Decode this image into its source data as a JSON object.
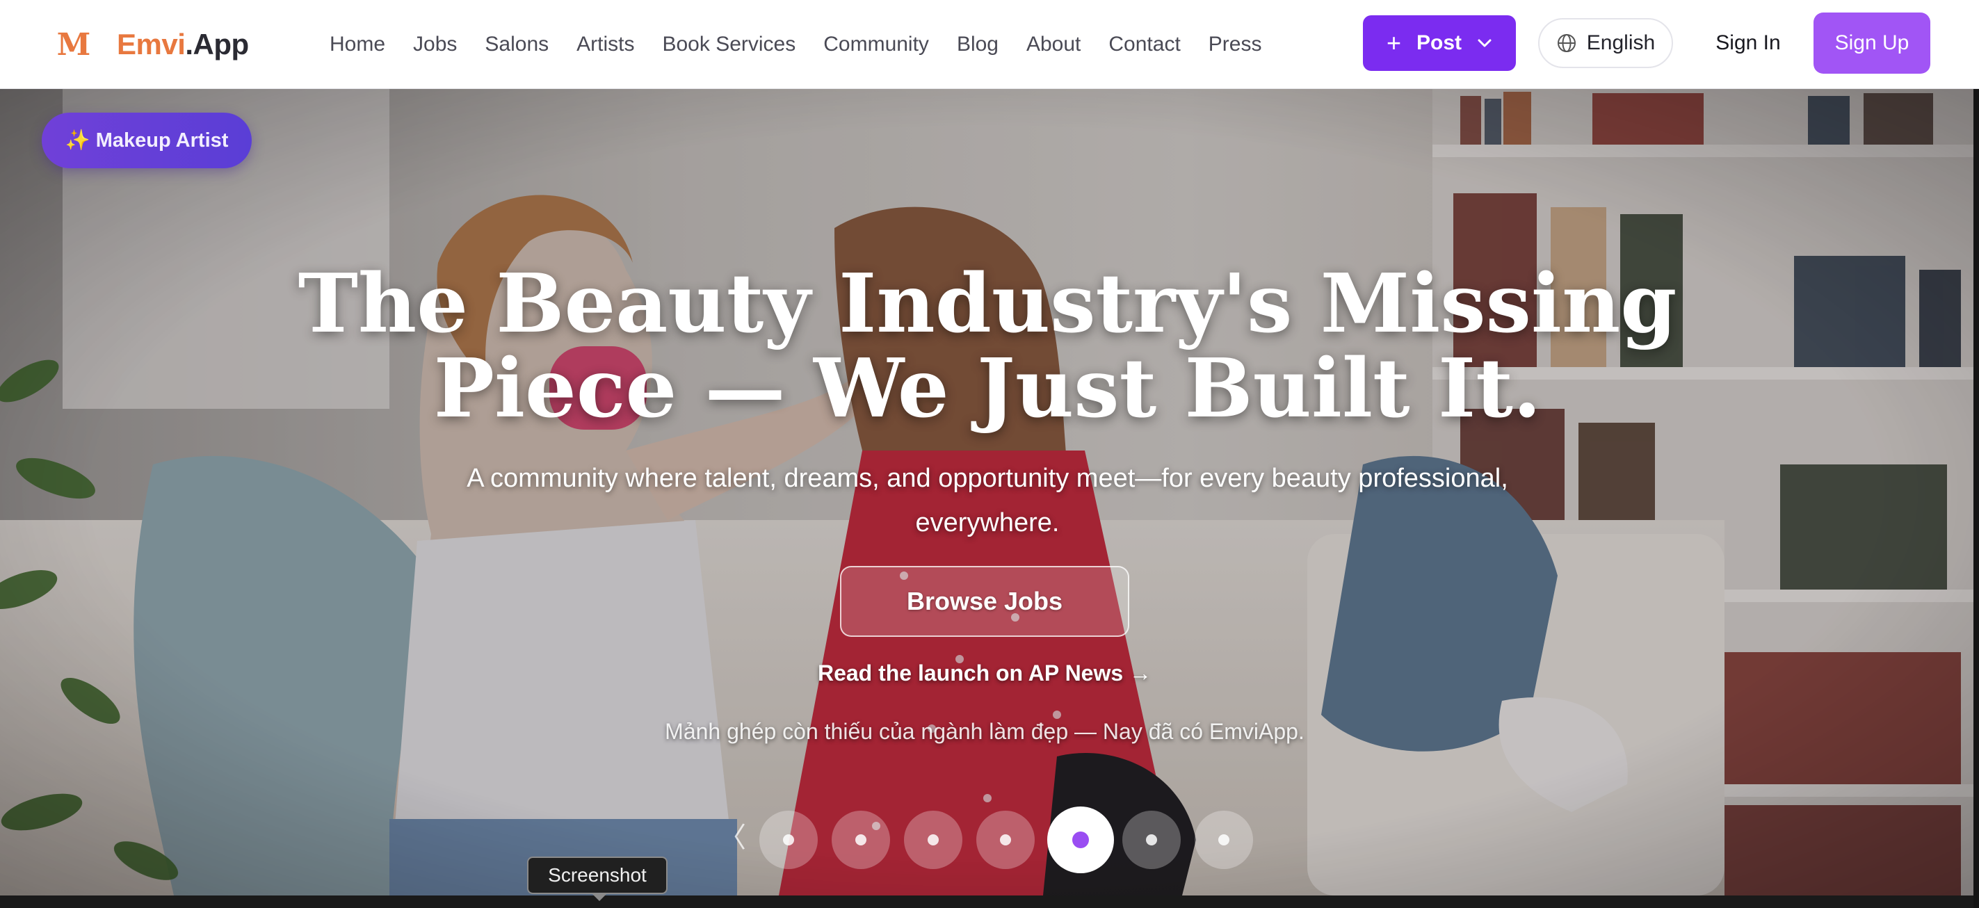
{
  "brand": {
    "mark": "M",
    "name_accent": "Emvi",
    "name_rest": ".App"
  },
  "nav": {
    "links": [
      "Home",
      "Jobs",
      "Salons",
      "Artists",
      "Book Services",
      "Community",
      "Blog",
      "About",
      "Contact",
      "Press"
    ]
  },
  "actions": {
    "post_label": "Post",
    "language_label": "English",
    "signin_label": "Sign In",
    "signup_label": "Sign Up"
  },
  "hero": {
    "category_badge": "✨ Makeup Artist",
    "title_line1": "The Beauty Industry's Missing",
    "title_line2": "Piece — We Just Built It.",
    "subtitle": "A community where talent, dreams, and opportunity meet—for every beauty professional, everywhere.",
    "cta_label": "Browse Jobs",
    "press_link": "Read the launch on AP News →",
    "vietnamese_tagline": "Mảnh ghép còn thiếu của ngành làm đẹp — Nay đã có EmviApp.",
    "carousel": {
      "slide_count": 7,
      "active_index": 4,
      "prev_icon": "chevron-left-icon"
    }
  },
  "tooltip": {
    "text": "Screenshot"
  },
  "colors": {
    "brand_orange": "#e8783f",
    "post_purple": "#7b2cf0",
    "signup_purple": "#a155f5",
    "badge_purple": "#6a40d8",
    "carousel_active": "#9a4df2"
  }
}
